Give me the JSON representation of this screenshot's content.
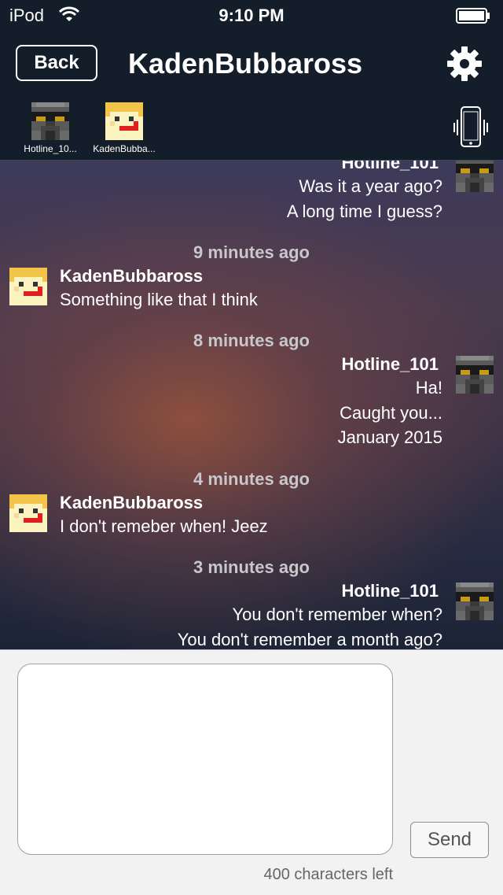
{
  "status_bar": {
    "carrier": "iPod",
    "time": "9:10 PM"
  },
  "navbar": {
    "back_label": "Back",
    "title": "KadenBubbaross",
    "settings_icon": "gear-icon"
  },
  "participants": [
    {
      "name": "Hotline_10...",
      "avatar": "dark-helmet-avatar"
    },
    {
      "name": "KadenBubba...",
      "avatar": "yellow-face-avatar"
    }
  ],
  "messages": {
    "m0": {
      "sender": "Hotline_101",
      "lines": [
        "Was it a year ago?",
        "A long time I guess?"
      ]
    },
    "t1": "9 minutes ago",
    "m1": {
      "sender": "KadenBubbaross",
      "lines": [
        "Something like that I think"
      ]
    },
    "t2": "8 minutes ago",
    "m2": {
      "sender": "Hotline_101",
      "lines": [
        "Ha!",
        "Caught you...",
        "January 2015"
      ]
    },
    "t3": "4 minutes ago",
    "m3": {
      "sender": "KadenBubbaross",
      "lines": [
        "I don't remeber when! Jeez"
      ]
    },
    "t4": "3 minutes ago",
    "m4": {
      "sender": "Hotline_101",
      "lines": [
        "You don't remember when?",
        "You don't remember a month ago?"
      ]
    }
  },
  "composer": {
    "input_value": "",
    "send_label": "Send",
    "char_count": "400 characters left"
  },
  "colors": {
    "bar_bg": "#141e2a",
    "timestamp": "#c7c7cc",
    "composer_bg": "#f2f2f2"
  }
}
